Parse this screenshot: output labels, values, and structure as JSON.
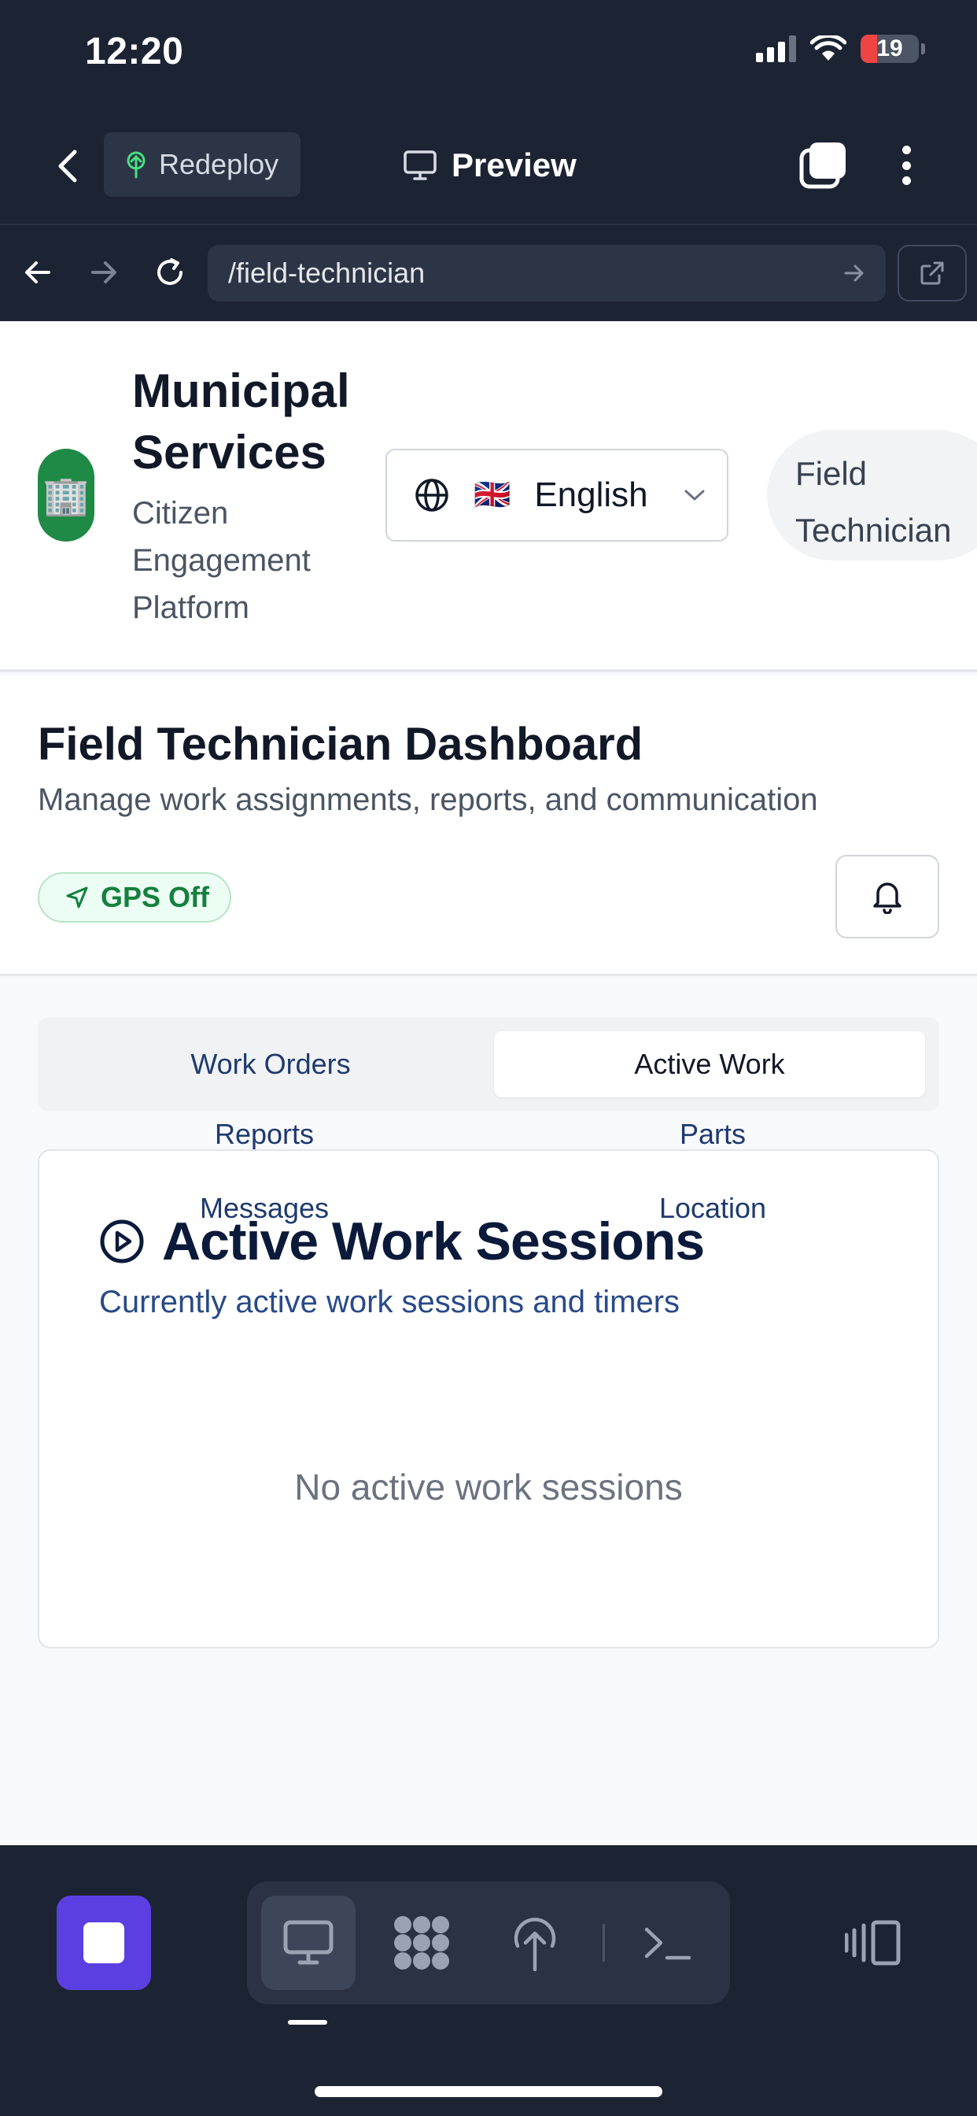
{
  "status_bar": {
    "time": "12:20",
    "battery": "19"
  },
  "browser": {
    "redeploy_label": "Redeploy",
    "preview_label": "Preview",
    "url": "/field-technician"
  },
  "header": {
    "logo_emoji": "🏢",
    "title": "Municipal Services",
    "subtitle": "Citizen Engagement Platform",
    "language": {
      "flag": "🇬🇧",
      "label": "English"
    },
    "role": "Field Technician"
  },
  "dashboard": {
    "title": "Field Technician Dashboard",
    "subtitle": "Manage work assignments, reports, and communication",
    "gps_status": "GPS Off"
  },
  "tabs": [
    {
      "label": "Work Orders",
      "active": false
    },
    {
      "label": "Active Work",
      "active": true
    },
    {
      "label": "Reports",
      "active": false
    },
    {
      "label": "Parts",
      "active": false
    },
    {
      "label": "Messages",
      "active": false
    },
    {
      "label": "Location",
      "active": false
    }
  ],
  "card": {
    "title": "Active Work Sessions",
    "subtitle": "Currently active work sessions and timers",
    "empty_text": "No active work sessions"
  },
  "toolbar": {
    "icons": [
      "stop-icon",
      "monitor-icon",
      "grid-icon",
      "deploy-icon",
      "terminal-icon",
      "panel-icon"
    ]
  },
  "colors": {
    "chrome_bg": "#1c2333",
    "accent_purple": "#5b3fe0",
    "gps_green": "#15803d",
    "logo_green": "#1f8a46"
  }
}
